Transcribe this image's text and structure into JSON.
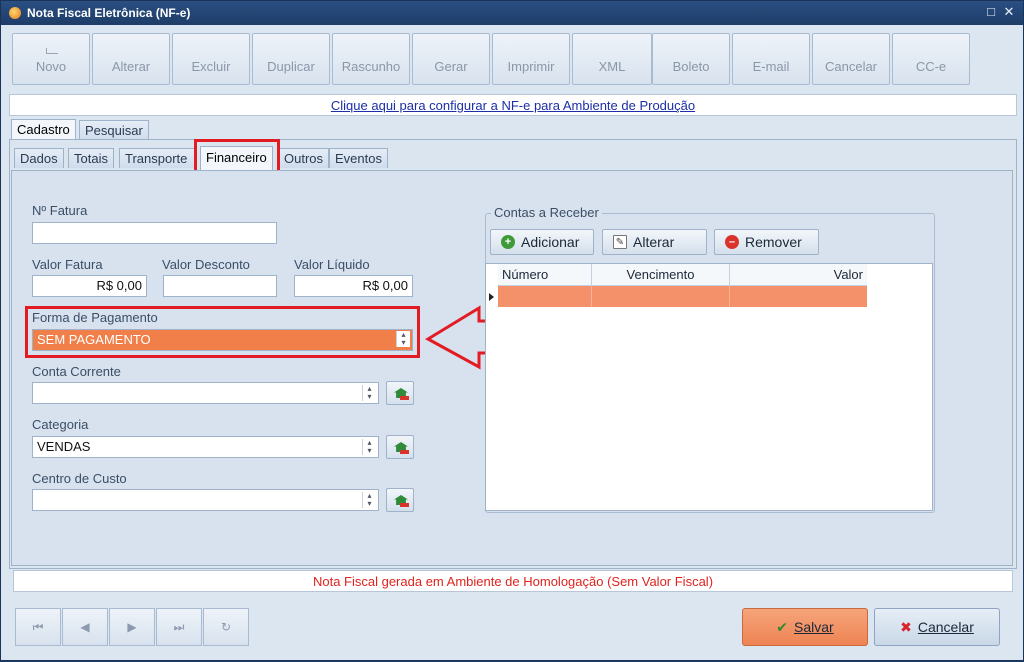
{
  "window": {
    "title": "Nota Fiscal Eletrônica (NF-e)",
    "controls": [
      "□",
      "✕"
    ]
  },
  "toolbar": [
    {
      "id": "novo",
      "label": "Novo",
      "underline": "N"
    },
    {
      "id": "alterar",
      "label": "Alterar",
      "underline": "A"
    },
    {
      "id": "excluir",
      "label": "Excluir",
      "underline": "E"
    },
    {
      "id": "duplicar",
      "label": "Duplicar"
    },
    {
      "id": "rascunho",
      "label": "Rascunho"
    },
    {
      "id": "gerar",
      "label": "Gerar"
    },
    {
      "id": "imprimir",
      "label": "Imprimir"
    },
    {
      "id": "xml",
      "label": "XML"
    },
    {
      "id": "boleto",
      "label": "Boleto"
    },
    {
      "id": "email",
      "label": "E-mail"
    },
    {
      "id": "cancelar",
      "label": "Cancelar"
    },
    {
      "id": "cce",
      "label": "CC-e"
    }
  ],
  "config_link": "Clique aqui para configurar a NF-e para Ambiente de Produção",
  "main_tabs": [
    "Cadastro",
    "Pesquisar"
  ],
  "sub_tabs": [
    "Dados",
    "Totais",
    "Transporte",
    "Financeiro",
    "Outros",
    "Eventos"
  ],
  "form": {
    "fatura_label": "Nº Fatura",
    "fatura_value": "",
    "valor_fatura_label": "Valor Fatura",
    "valor_fatura_value": "R$ 0,00",
    "valor_desconto_label": "Valor Desconto",
    "valor_desconto_value": "",
    "valor_liquido_label": "Valor Líquido",
    "valor_liquido_value": "R$ 0,00",
    "forma_pagamento_label": "Forma de Pagamento",
    "forma_pagamento_value": "SEM PAGAMENTO",
    "conta_corrente_label": "Conta Corrente",
    "conta_corrente_value": "",
    "categoria_label": "Categoria",
    "categoria_value": "VENDAS",
    "centro_custo_label": "Centro de Custo",
    "centro_custo_value": ""
  },
  "contas": {
    "title": "Contas a Receber",
    "add_label": "Adicionar",
    "edit_label": "Alterar",
    "remove_label": "Remover",
    "columns": [
      "Número",
      "Vencimento",
      "Valor"
    ]
  },
  "status_message": "Nota Fiscal gerada em Ambiente de Homologação (Sem Valor Fiscal)",
  "nav": [
    "⏮",
    "◀",
    "▶",
    "⏭",
    "↻"
  ],
  "actions": {
    "save_label": "Salvar",
    "cancel_label": "Cancelar"
  },
  "colors": {
    "accent_orange": "#f07f4a",
    "highlight_red": "#e31b23",
    "status_red": "#e0231e"
  }
}
